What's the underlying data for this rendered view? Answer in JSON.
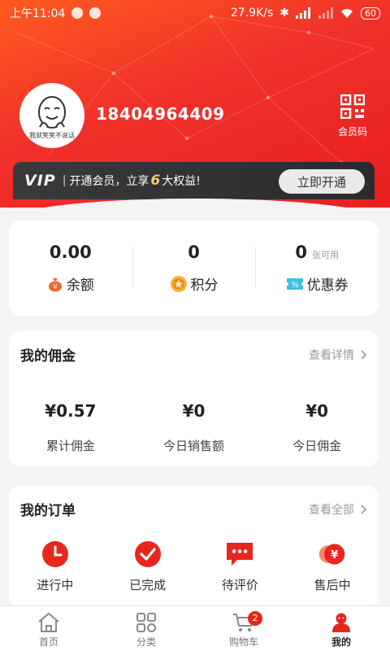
{
  "status_bar": {
    "time": "上午11:04",
    "network_speed": "27.9K/s",
    "battery": "60"
  },
  "profile": {
    "avatar_caption": "我就笑笑不说话",
    "phone": "18404964409",
    "member_code_label": "会员码"
  },
  "vip": {
    "logo": "VIP",
    "separator": "|",
    "text_before": "开通会员，立享",
    "highlight": "6",
    "text_after": "大权益!",
    "button": "立即开通"
  },
  "assets": [
    {
      "value": "0.00",
      "unit": "",
      "label": "余额",
      "icon": "money-bag-icon"
    },
    {
      "value": "0",
      "unit": "",
      "label": "积分",
      "icon": "points-icon"
    },
    {
      "value": "0",
      "unit": "张可用",
      "label": "优惠券",
      "icon": "coupon-icon"
    }
  ],
  "commission": {
    "title": "我的佣金",
    "more": "查看详情",
    "items": [
      {
        "value": "¥0.57",
        "label": "累计佣金"
      },
      {
        "value": "¥0",
        "label": "今日销售额"
      },
      {
        "value": "¥0",
        "label": "今日佣金"
      }
    ]
  },
  "orders": {
    "title": "我的订单",
    "more": "查看全部",
    "items": [
      {
        "label": "进行中",
        "icon": "clock-icon"
      },
      {
        "label": "已完成",
        "icon": "check-icon"
      },
      {
        "label": "待评价",
        "icon": "comment-icon"
      },
      {
        "label": "售后中",
        "icon": "refund-icon"
      }
    ]
  },
  "tabbar": {
    "items": [
      {
        "label": "首页",
        "icon": "home-icon"
      },
      {
        "label": "分类",
        "icon": "category-icon"
      },
      {
        "label": "购物车",
        "icon": "cart-icon"
      },
      {
        "label": "我的",
        "icon": "user-icon"
      }
    ],
    "cart_badge": "2",
    "active": "我的"
  },
  "colors": {
    "brand_red": "#e8251f",
    "header_gradient_start": "#ff5a1f",
    "vip_bar": "#2f2f32",
    "vip_highlight": "#f3c96b"
  }
}
